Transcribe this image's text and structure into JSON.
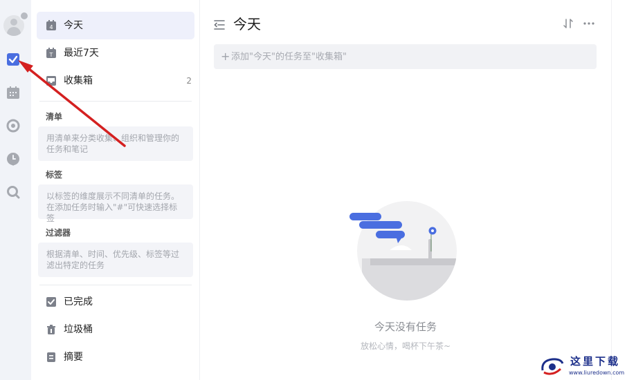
{
  "rail": {
    "icons": [
      "avatar",
      "checkbox-icon",
      "calendar-icon",
      "focus-icon",
      "clock-icon",
      "search-icon"
    ],
    "accent": "#4a6ee0",
    "icon_color": "#a6a9b0"
  },
  "sidebar": {
    "smart_lists": [
      {
        "label": "今天",
        "date": "4",
        "active": true
      },
      {
        "label": "最近7天",
        "date": "T"
      },
      {
        "label": "收集箱",
        "count": "2"
      }
    ],
    "sections": [
      {
        "title": "清单",
        "hint": "用清单来分类收集、组织和管理你的任务和笔记"
      },
      {
        "title": "标签",
        "hint": "以标签的维度展示不同清单的任务。在添加任务时输入\"#\"可快速选择标签"
      },
      {
        "title": "过滤器",
        "hint": "根据清单、时间、优先级、标签等过滤出特定的任务"
      }
    ],
    "bottom": [
      {
        "label": "已完成"
      },
      {
        "label": "垃圾桶"
      },
      {
        "label": "摘要"
      }
    ]
  },
  "main": {
    "title": "今天",
    "add_placeholder": "添加\"今天\"的任务至\"收集箱\"",
    "empty_title": "今天没有任务",
    "empty_subtitle": "放松心情，喝杯下午茶~"
  },
  "watermark": {
    "text": "这里下载",
    "url": "www.liuredown.com"
  }
}
